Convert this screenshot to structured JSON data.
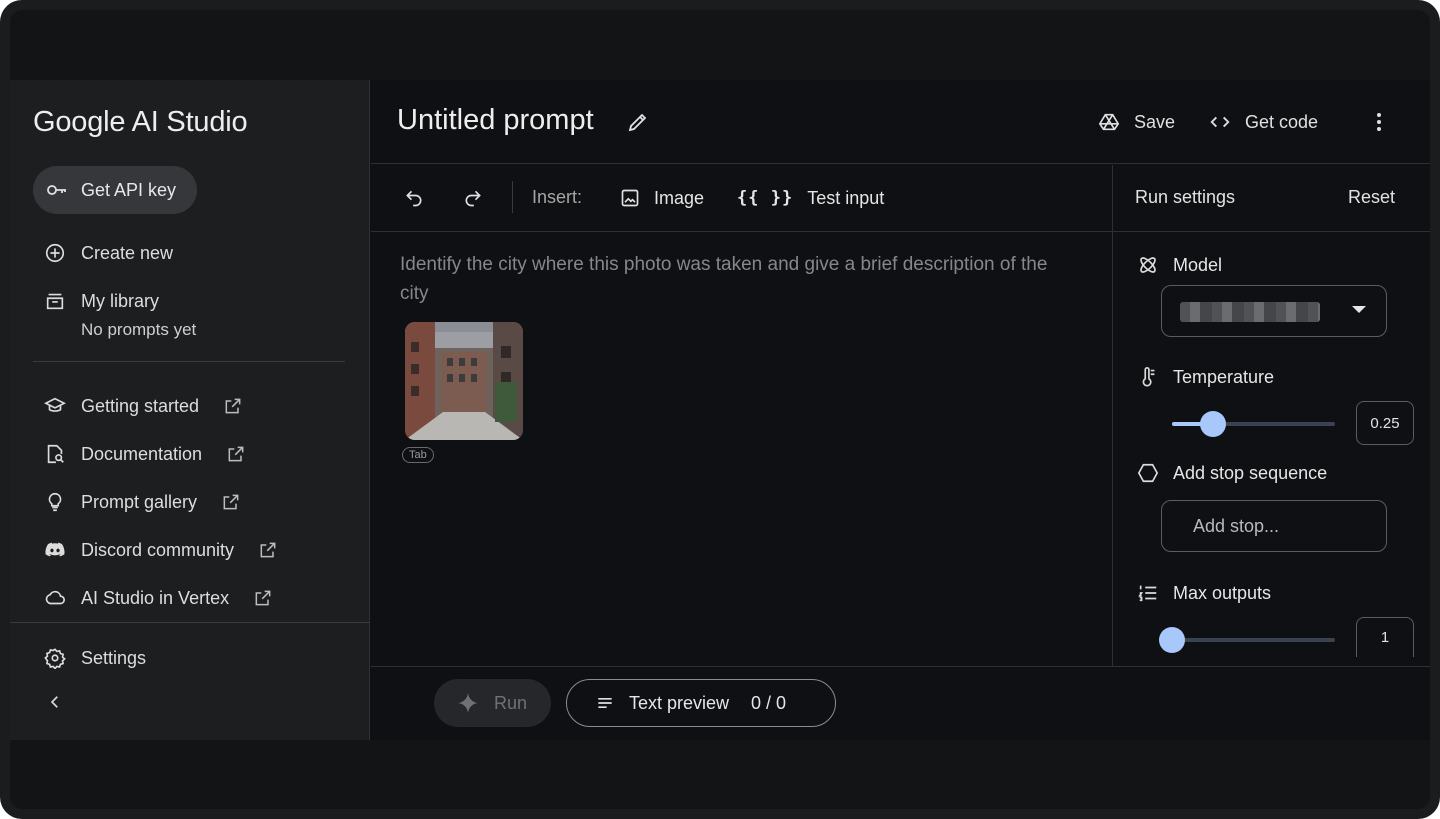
{
  "sidebar": {
    "brand": "Google AI Studio",
    "api_key_label": "Get API key",
    "create_new": "Create new",
    "my_library": "My library",
    "no_prompts": "No prompts yet",
    "links": [
      {
        "label": "Getting started",
        "icon": "graduation-cap-icon"
      },
      {
        "label": "Documentation",
        "icon": "document-search-icon"
      },
      {
        "label": "Prompt gallery",
        "icon": "lightbulb-icon"
      },
      {
        "label": "Discord community",
        "icon": "discord-icon"
      },
      {
        "label": "AI Studio in Vertex",
        "icon": "cloud-icon"
      }
    ],
    "settings": "Settings"
  },
  "header": {
    "title": "Untitled prompt",
    "save": "Save",
    "get_code": "Get code"
  },
  "toolbar": {
    "insert_label": "Insert:",
    "image": "Image",
    "test_input_glyph": "{{ }}",
    "test_input": "Test input"
  },
  "prompt": {
    "text": "Identify the city where this photo was taken and give a brief description of the city",
    "chip": "Tab"
  },
  "bottom": {
    "run": "Run",
    "text_preview": "Text preview",
    "count": "0 / 0"
  },
  "run_settings": {
    "title": "Run settings",
    "reset": "Reset",
    "model_label": "Model",
    "temperature_label": "Temperature",
    "temperature_value": "0.25",
    "temperature_fraction": 0.25,
    "stop_label": "Add stop sequence",
    "stop_placeholder": "Add stop...",
    "max_outputs_label": "Max outputs",
    "max_outputs_value": "1",
    "max_outputs_fraction": 0
  },
  "colors": {
    "accent": "#a8c7fa",
    "background": "#0f1013",
    "sidebar": "#1d1e20"
  }
}
